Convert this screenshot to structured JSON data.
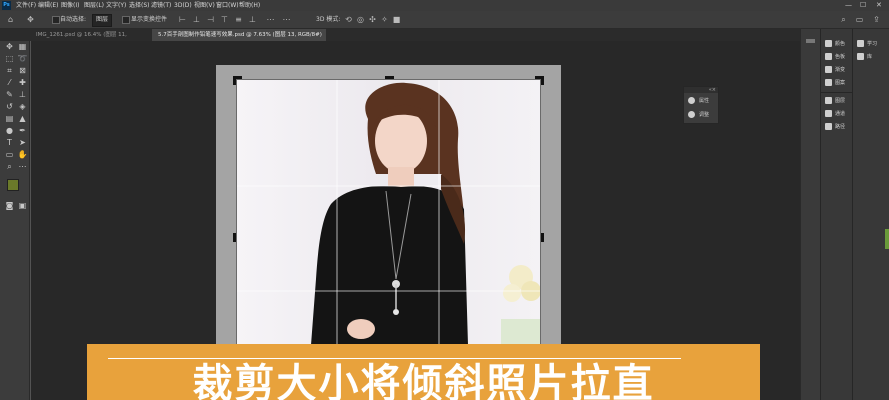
{
  "menubar": {
    "app_logo": "Ps",
    "items": [
      "文件(F)",
      "编辑(E)",
      "图像(I)",
      "图层(L)",
      "文字(Y)",
      "选择(S)",
      "滤镜(T)",
      "3D(D)",
      "视图(V)",
      "窗口(W)",
      "帮助(H)"
    ],
    "window_controls": [
      "—",
      "☐",
      "✕"
    ]
  },
  "options": {
    "auto_select_label": "自动选择:",
    "auto_select_value": "图层",
    "show_transform_label": "显示变换控件",
    "mode_3d_label": "3D 模式:"
  },
  "tabs": [
    {
      "label": "IMG_1261.psd @ 16.4% (图层 11, RGB/8*)",
      "close": "×"
    },
    {
      "label": "5.7百手剖图制作铅笔速写效果.psd @ 7.63% (图层 13, RGB/8#) *",
      "close": "×"
    }
  ],
  "float_panel": {
    "items": [
      {
        "label": "属性",
        "icon": "properties-icon"
      },
      {
        "label": "调整",
        "icon": "adjustments-icon"
      }
    ]
  },
  "panel1": {
    "items": [
      {
        "label": "颜色",
        "icon": "color-icon"
      },
      {
        "label": "色板",
        "icon": "swatches-icon"
      },
      {
        "label": "渐变",
        "icon": "gradients-icon"
      },
      {
        "label": "图案",
        "icon": "patterns-icon"
      },
      {
        "label": "图层",
        "icon": "layers-icon"
      },
      {
        "label": "通道",
        "icon": "channels-icon"
      },
      {
        "label": "路径",
        "icon": "paths-icon"
      }
    ]
  },
  "panel2": {
    "items": [
      {
        "label": "学习",
        "icon": "learn-icon"
      },
      {
        "label": "库",
        "icon": "libraries-icon"
      }
    ]
  },
  "banner": {
    "text": "裁剪大小将倾斜照片拉直"
  },
  "colors": {
    "foreground": "#6b7a2a",
    "background": "#ffffff",
    "banner": "#e8a23c"
  }
}
